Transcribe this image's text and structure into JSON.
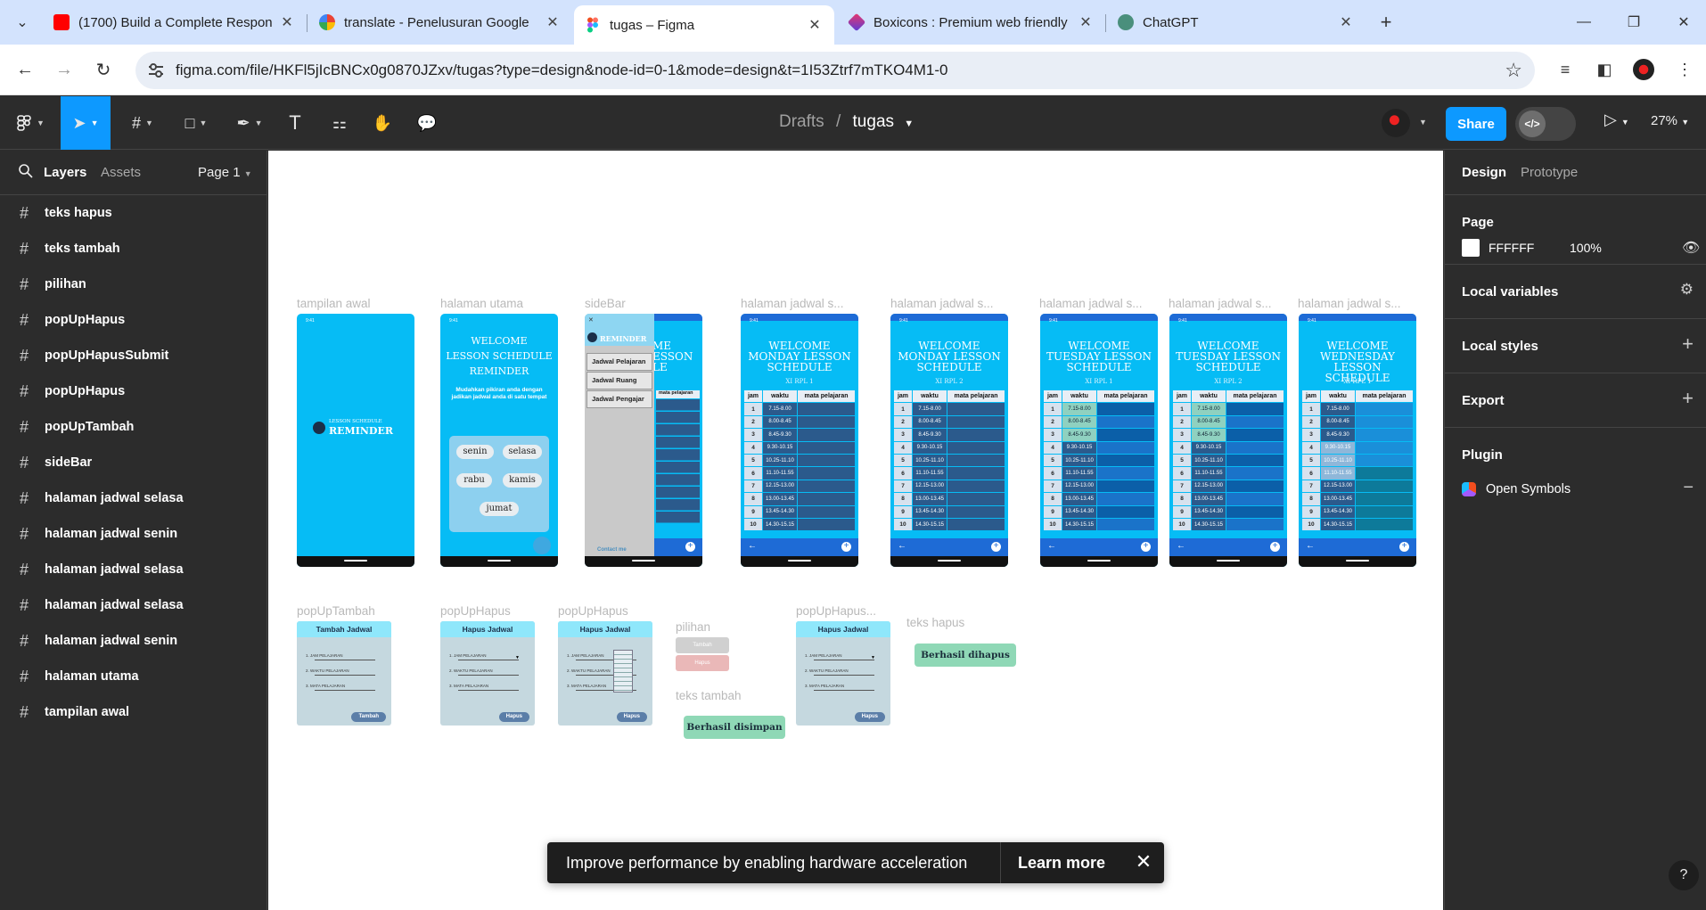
{
  "browser": {
    "tabs": [
      {
        "title": "(1700) Build a Complete Respon",
        "icon": "youtube-icon"
      },
      {
        "title": "translate - Penelusuran Google",
        "icon": "google-icon"
      },
      {
        "title": "tugas – Figma",
        "icon": "figma-icon",
        "active": true
      },
      {
        "title": "Boxicons : Premium web friendly",
        "icon": "boxicons-icon"
      },
      {
        "title": "ChatGPT",
        "icon": "chatgpt-icon"
      }
    ],
    "url": "figma.com/file/HKFl5jIcBNCx0g0870JZxv/tugas?type=design&node-id=0-1&mode=design&t=1I53Ztrf7mTKO4M1-0"
  },
  "figma": {
    "breadcrumb": {
      "parent": "Drafts",
      "separator": "/",
      "file": "tugas"
    },
    "share_label": "Share",
    "dev_mode_label": "</>",
    "zoom": "27%"
  },
  "left_panel": {
    "tab_layers": "Layers",
    "tab_assets": "Assets",
    "page": "Page 1",
    "layers": [
      "teks hapus",
      "teks tambah",
      "pilihan",
      "popUpHapus",
      "popUpHapusSubmit",
      "popUpHapus",
      "popUpTambah",
      "sideBar",
      "halaman jadwal selasa",
      "halaman jadwal senin",
      "halaman jadwal selasa",
      "halaman jadwal selasa",
      "halaman jadwal senin",
      "halaman utama",
      "tampilan awal"
    ]
  },
  "canvas": {
    "frame_labels": {
      "tampilan_awal": "tampilan awal",
      "halaman_utama": "halaman utama",
      "sidebar": "sideBar",
      "jadwal": "halaman jadwal s...",
      "popup_tambah": "popUpTambah",
      "popup_hapus": "popUpHapus",
      "pilihan": "pilihan",
      "popup_hapus_submit": "popUpHapus...",
      "teks_tambah": "teks tambah",
      "teks_hapus": "teks hapus"
    },
    "splash": {
      "line1": "LESSON SCHEDULE",
      "line2": "REMINDER"
    },
    "home": {
      "welcome": "WELCOME",
      "title1": "LESSON SCHEDULE",
      "title2": "REMINDER",
      "subtitle": "Mudahkan pikiran anda dengan jadikan jadwal anda di satu tempat",
      "days": [
        "senin",
        "selasa",
        "rabu",
        "kamis",
        "jumat"
      ]
    },
    "sidebar": {
      "logo": "REMINDER",
      "items": [
        "Jadwal Pelajaran",
        "Jadwal Ruang",
        "Jadwal Pengajar"
      ],
      "contact": "Contact me"
    },
    "schedules": [
      {
        "day": "MONDAY",
        "class": "XI RPL 1"
      },
      {
        "day": "MONDAY",
        "class": "XI RPL 2"
      },
      {
        "day": "TUESDAY",
        "class": "XI RPL 1"
      },
      {
        "day": "TUESDAY",
        "class": "XI RPL 2"
      },
      {
        "day": "WEDNESDAY",
        "class": "XI RPL 1"
      }
    ],
    "schedule_welcome": "WELCOME",
    "schedule_suffix": "LESSON SCHEDULE",
    "table_headers": [
      "jam",
      "waktu",
      "mata pelajaran"
    ],
    "times": [
      "7.15-8.00",
      "8.00-8.45",
      "8.45-9.30",
      "9.30-10.15",
      "10.25-11.10",
      "11.10-11.55",
      "12.15-13.00",
      "13.00-13.45",
      "13.45-14.30",
      "14.30-15.15"
    ],
    "popups": {
      "tambah_title": "Tambah Jadwal",
      "hapus_title": "Hapus Jadwal",
      "fields": [
        "1. JAM PELAJARAN",
        "2. WAKTU PELAJARAN",
        "3. MATA PELAJARAN"
      ],
      "tambah_btn": "Tambah",
      "hapus_btn": "Hapus"
    },
    "pilihan": {
      "tambah": "Tambah",
      "hapus": "Hapus"
    },
    "toast_saved": "Berhasil disimpan",
    "toast_deleted": "Berhasil dihapus"
  },
  "hw_toast": {
    "message": "Improve performance by enabling hardware acceleration",
    "learn_more": "Learn more"
  },
  "right_panel": {
    "tab_design": "Design",
    "tab_prototype": "Prototype",
    "page_label": "Page",
    "page_color": "FFFFFF",
    "page_opacity": "100%",
    "local_variables": "Local variables",
    "local_styles": "Local styles",
    "export": "Export",
    "plugin": "Plugin",
    "plugin_name": "Open Symbols"
  },
  "colors": {
    "accent": "#0d99ff",
    "phone_bg": "#06bcf5",
    "toast_green": "#8fd8b6"
  }
}
